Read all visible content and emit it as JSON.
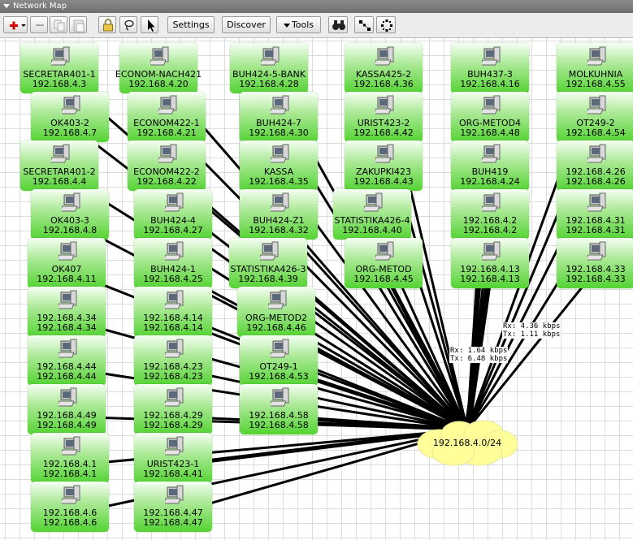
{
  "window": {
    "title": "Network Map"
  },
  "toolbar": {
    "settings_label": "Settings",
    "discover_label": "Discover",
    "tools_label": "Tools",
    "icons": [
      "add-icon",
      "remove-icon",
      "copy-icon",
      "paste-icon",
      "lock-icon",
      "lasso-icon",
      "pointer-icon",
      "binoculars-icon",
      "auto-layout-icon",
      "circle-layout-icon"
    ]
  },
  "map": {
    "network": {
      "label": "192.168.4.0/24",
      "color": "#ffff99"
    },
    "node_color": "#54d332",
    "traffic_labels": [
      {
        "rx": "Rx: 1.64 kbps",
        "tx": "Tx: 6.48 kbps"
      },
      {
        "rx": "Rx: 4.36 kbps",
        "tx": "Tx: 1.11 kbps"
      }
    ],
    "nodes": [
      {
        "name": "SECRETAR401-1",
        "ip": "192.168.4.3"
      },
      {
        "name": "ECONOM-NACH421",
        "ip": "192.168.4.20"
      },
      {
        "name": "BUH424-5-BANK",
        "ip": "192.168.4.28"
      },
      {
        "name": "KASSA425-2",
        "ip": "192.168.4.36"
      },
      {
        "name": "BUH437-3",
        "ip": "192.168.4.16"
      },
      {
        "name": "MOLKUHNIA",
        "ip": "192.168.4.55"
      },
      {
        "name": "OK403-2",
        "ip": "192.168.4.7"
      },
      {
        "name": "ECONOM422-1",
        "ip": "192.168.4.21"
      },
      {
        "name": "BUH424-7",
        "ip": "192.168.4.30"
      },
      {
        "name": "URIST423-2",
        "ip": "192.168.4.42"
      },
      {
        "name": "ORG-METOD4",
        "ip": "192.168.4.48"
      },
      {
        "name": "OT249-2",
        "ip": "192.168.4.54"
      },
      {
        "name": "SECRETAR401-2",
        "ip": "192.168.4.4"
      },
      {
        "name": "ECONOM422-2",
        "ip": "192.168.4.22"
      },
      {
        "name": "KASSA",
        "ip": "192.168.4.35"
      },
      {
        "name": "ZAKUPKI423",
        "ip": "192.168.4.43"
      },
      {
        "name": "BUH419",
        "ip": "192.168.4.24"
      },
      {
        "name": "192.168.4.26",
        "ip": "192.168.4.26"
      },
      {
        "name": "OK403-3",
        "ip": "192.168.4.8"
      },
      {
        "name": "BUH424-4",
        "ip": "192.168.4.27"
      },
      {
        "name": "BUH424-Z1",
        "ip": "192.168.4.32"
      },
      {
        "name": "STATISTIKA426-4",
        "ip": "192.168.4.40"
      },
      {
        "name": "192.168.4.2",
        "ip": "192.168.4.2"
      },
      {
        "name": "192.168.4.31",
        "ip": "192.168.4.31"
      },
      {
        "name": "OK407",
        "ip": "192.168.4.11"
      },
      {
        "name": "BUH424-1",
        "ip": "192.168.4.25"
      },
      {
        "name": "STATISTIKA426-3",
        "ip": "192.168.4.39"
      },
      {
        "name": "ORG-METOD",
        "ip": "192.168.4.45"
      },
      {
        "name": "192.168.4.13",
        "ip": "192.168.4.13"
      },
      {
        "name": "192.168.4.33",
        "ip": "192.168.4.33"
      },
      {
        "name": "192.168.4.34",
        "ip": "192.168.4.34"
      },
      {
        "name": "192.168.4.14",
        "ip": "192.168.4.14"
      },
      {
        "name": "ORG-METOD2",
        "ip": "192.168.4.46"
      },
      {
        "name": "192.168.4.44",
        "ip": "192.168.4.44"
      },
      {
        "name": "192.168.4.23",
        "ip": "192.168.4.23"
      },
      {
        "name": "OT249-1",
        "ip": "192.168.4.53"
      },
      {
        "name": "192.168.4.49",
        "ip": "192.168.4.49"
      },
      {
        "name": "192.168.4.29",
        "ip": "192.168.4.29"
      },
      {
        "name": "192.168.4.58",
        "ip": "192.168.4.58"
      },
      {
        "name": "192.168.4.1",
        "ip": "192.168.4.1"
      },
      {
        "name": "URIST423-1",
        "ip": "192.168.4.41"
      },
      {
        "name": "192.168.4.6",
        "ip": "192.168.4.6"
      },
      {
        "name": "192.168.4.47",
        "ip": "192.168.4.47"
      }
    ]
  }
}
